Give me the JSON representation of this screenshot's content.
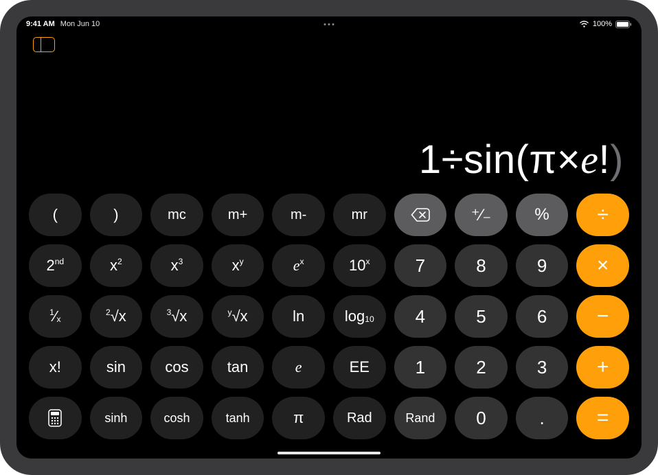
{
  "status": {
    "time": "9:41 AM",
    "date": "Mon Jun 10",
    "battery_pct": "100%"
  },
  "display": {
    "prefix": "1÷sin(π×",
    "e": "e",
    "excl": "!",
    "close": ")"
  },
  "keys": {
    "r1": {
      "lp": "(",
      "rp": ")",
      "mc": "mc",
      "mp": "m+",
      "mm": "m-",
      "mr": "mr",
      "pm": "⁺∕₋",
      "pct": "%",
      "div": "÷"
    },
    "r2": {
      "second_a": "2",
      "second_b": "nd",
      "x2_a": "x",
      "x2_b": "2",
      "x3_a": "x",
      "x3_b": "3",
      "xy_a": "x",
      "xy_b": "y",
      "ex_a": "e",
      "ex_b": "x",
      "tenx_a": "10",
      "tenx_b": "x",
      "n7": "7",
      "n8": "8",
      "n9": "9",
      "mul": "×"
    },
    "r3": {
      "inv_a": "1",
      "inv_b": "x",
      "root2_a": "2",
      "root2_b": "√x",
      "root3_a": "3",
      "root3_b": "√x",
      "rooty_a": "y",
      "rooty_b": "√x",
      "ln": "ln",
      "log_a": "log",
      "log_b": "10",
      "n4": "4",
      "n5": "5",
      "n6": "6",
      "sub": "−"
    },
    "r4": {
      "fact": "x!",
      "sin": "sin",
      "cos": "cos",
      "tan": "tan",
      "e": "e",
      "ee": "EE",
      "n1": "1",
      "n2": "2",
      "n3": "3",
      "add": "+"
    },
    "r5": {
      "sinh": "sinh",
      "cosh": "cosh",
      "tanh": "tanh",
      "pi": "π",
      "rad": "Rad",
      "rand": "Rand",
      "n0": "0",
      "dot": ".",
      "eq": "="
    }
  }
}
